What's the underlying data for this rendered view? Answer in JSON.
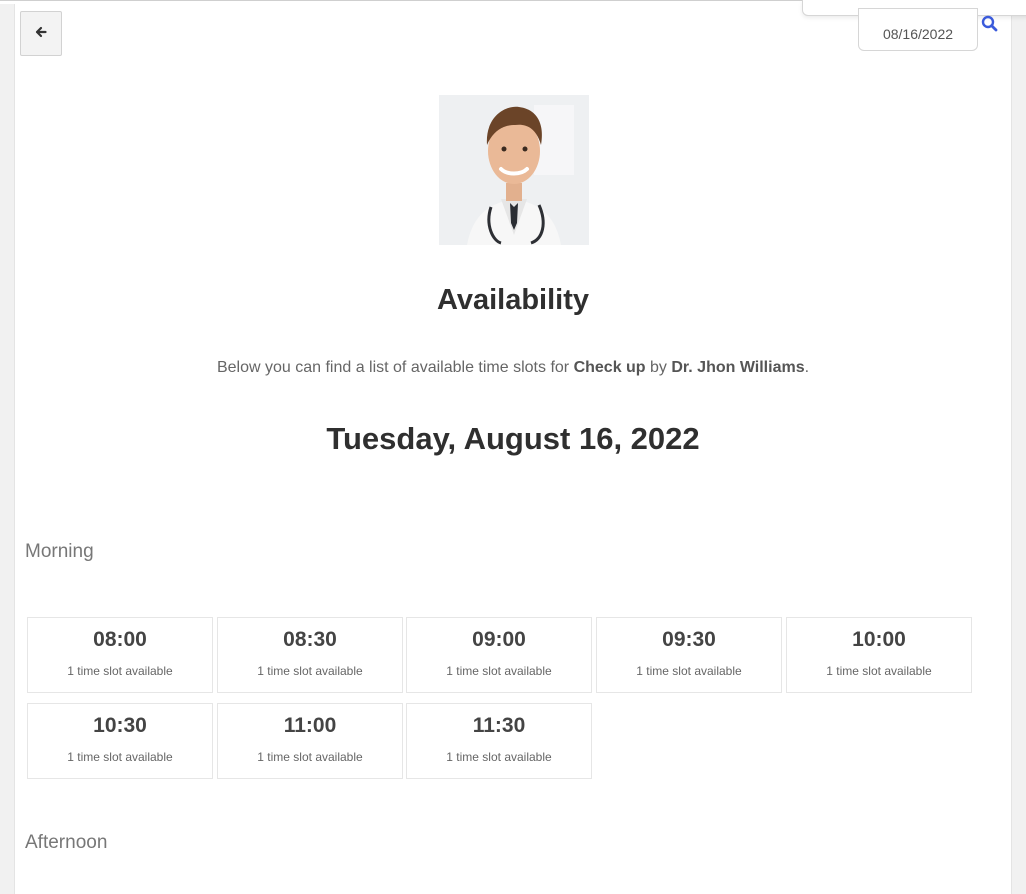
{
  "toolbar": {
    "back_icon": "arrow-left-icon",
    "date_value": "08/16/2022",
    "search_icon": "search-icon"
  },
  "doctor": {
    "avatar": "doctor-photo"
  },
  "main": {
    "title": "Availability",
    "intro_prefix": "Below you can find a list of available time slots for ",
    "service": "Check up",
    "intro_by": " by ",
    "provider": "Dr. Jhon Williams",
    "intro_suffix": ".",
    "date_heading": "Tuesday, August 16, 2022"
  },
  "sections": {
    "morning": "Morning",
    "afternoon": "Afternoon"
  },
  "slots": [
    {
      "time": "08:00",
      "label": "1 time slot available"
    },
    {
      "time": "08:30",
      "label": "1 time slot available"
    },
    {
      "time": "09:00",
      "label": "1 time slot available"
    },
    {
      "time": "09:30",
      "label": "1 time slot available"
    },
    {
      "time": "10:00",
      "label": "1 time slot available"
    },
    {
      "time": "10:30",
      "label": "1 time slot available"
    },
    {
      "time": "11:00",
      "label": "1 time slot available"
    },
    {
      "time": "11:30",
      "label": "1 time slot available"
    }
  ],
  "colors": {
    "accent": "#3b5bdb",
    "heading": "#2f2f2f"
  }
}
